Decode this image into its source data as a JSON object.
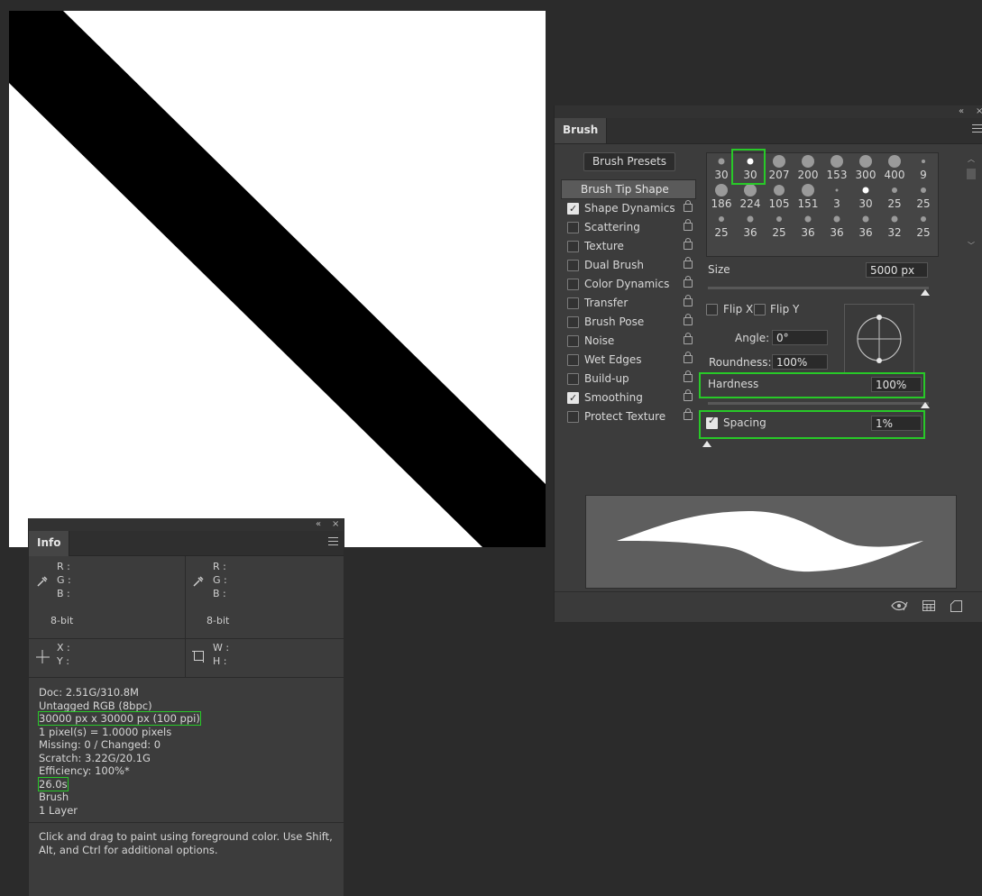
{
  "info_panel": {
    "tab": "Info",
    "collapse_icon": "«",
    "close_icon": "×",
    "color_labels_left": [
      "R :",
      "G :",
      "B :"
    ],
    "color_labels_right": [
      "R :",
      "G :",
      "B :"
    ],
    "bit_left": "8-bit",
    "bit_right": "8-bit",
    "xy_labels": [
      "X :",
      "Y :"
    ],
    "wh_labels": [
      "W :",
      "H :"
    ],
    "doc_lines": [
      "Doc: 2.51G/310.8M",
      "Untagged RGB (8bpc)",
      "30000 px x 30000 px (100 ppi)",
      "1 pixel(s) = 1.0000 pixels",
      "Missing: 0 / Changed: 0",
      "Scratch: 3.22G/20.1G",
      "Efficiency: 100%*",
      "26.0s",
      "Brush",
      "1 Layer"
    ],
    "hint_line1": "Click and drag to paint using foreground color.  Use Shift,",
    "hint_line2": "Alt, and Ctrl for additional options."
  },
  "brush_panel": {
    "tab": "Brush",
    "collapse_icon": "«",
    "close_icon": "×",
    "presets_button": "Brush Presets",
    "options_header": "Brush Tip Shape",
    "options": [
      {
        "label": "Shape Dynamics",
        "checked": true
      },
      {
        "label": "Scattering",
        "checked": false
      },
      {
        "label": "Texture",
        "checked": false
      },
      {
        "label": "Dual Brush",
        "checked": false
      },
      {
        "label": "Color Dynamics",
        "checked": false
      },
      {
        "label": "Transfer",
        "checked": false
      },
      {
        "label": "Brush Pose",
        "checked": false
      },
      {
        "label": "Noise",
        "checked": false
      },
      {
        "label": "Wet Edges",
        "checked": false
      },
      {
        "label": "Build-up",
        "checked": false
      },
      {
        "label": "Smoothing",
        "checked": true
      },
      {
        "label": "Protect Texture",
        "checked": false
      }
    ],
    "tip_sizes": [
      "30",
      "30",
      "207",
      "200",
      "153",
      "300",
      "400",
      "9",
      "186",
      "224",
      "105",
      "151",
      "3",
      "30",
      "25",
      "25",
      "25",
      "36",
      "25",
      "36",
      "36",
      "36",
      "32",
      "25"
    ],
    "selected_tip_index": 1,
    "size_label": "Size",
    "size_value": "5000 px",
    "flip_x": "Flip X",
    "flip_y": "Flip Y",
    "angle_label": "Angle:",
    "angle_value": "0°",
    "roundness_label": "Roundness:",
    "roundness_value": "100%",
    "hardness_label": "Hardness",
    "hardness_value": "100%",
    "spacing_label": "Spacing",
    "spacing_value": "1%",
    "spacing_checked": true
  },
  "colors": {
    "highlight": "#28c928",
    "panel_bg": "#3c3c3c",
    "workspace_bg": "#2b2b2b"
  }
}
